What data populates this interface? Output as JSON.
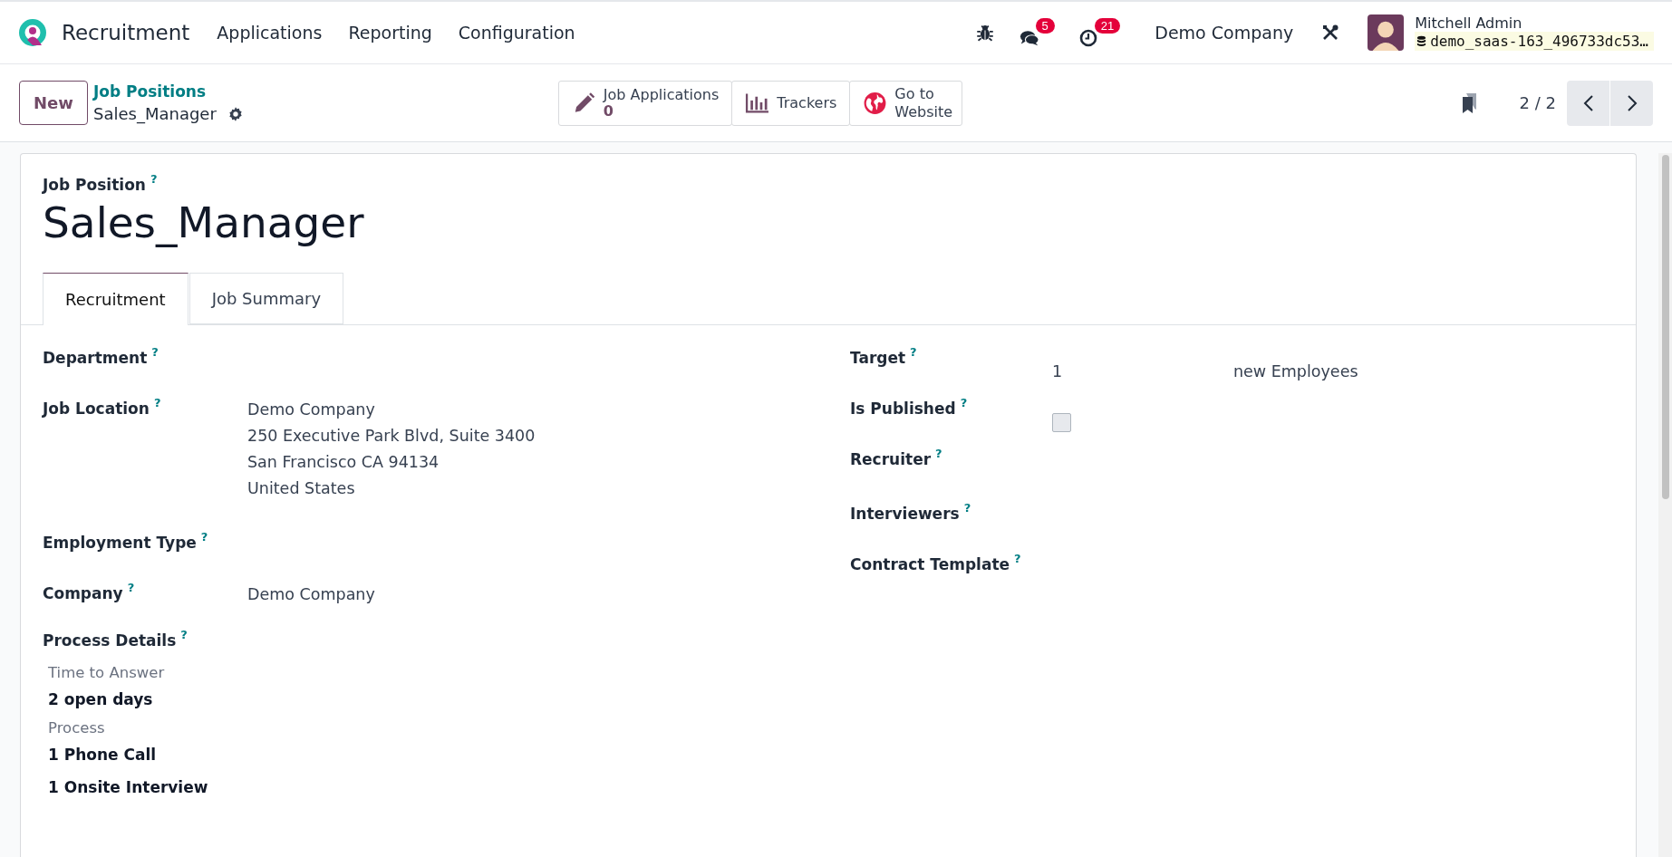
{
  "navbar": {
    "app_name": "Recruitment",
    "menu": [
      "Applications",
      "Reporting",
      "Configuration"
    ],
    "systray": {
      "messages_badge": "5",
      "activities_badge": "21",
      "company": "Demo Company",
      "user": "Mitchell Admin",
      "database": "demo_saas-163_496733dc53…"
    }
  },
  "control_panel": {
    "new_button": "New",
    "breadcrumb": {
      "parent": "Job Positions",
      "current": "Sales_Manager"
    },
    "smart_buttons": [
      {
        "kind": "stat",
        "label": "Job Applications",
        "value": "0"
      },
      {
        "kind": "plain",
        "label": "Trackers"
      },
      {
        "kind": "plain",
        "label": "Go to Website"
      }
    ],
    "pager": "2 / 2"
  },
  "form": {
    "title_label": "Job Position",
    "title_help": "?",
    "title": "Sales_Manager",
    "tabs": [
      {
        "label": "Recruitment",
        "selected": true
      },
      {
        "label": "Job Summary",
        "selected": false
      }
    ],
    "left_fields": [
      {
        "kind": "text",
        "label": "Department",
        "help": "?"
      },
      {
        "kind": "address",
        "label": "Job Location",
        "help": "?",
        "lines": [
          "Demo Company",
          "250 Executive Park Blvd, Suite 3400",
          "San Francisco CA 94134",
          "United States"
        ]
      },
      {
        "kind": "text",
        "label": "Employment Type",
        "help": "?"
      },
      {
        "kind": "text",
        "label": "Company",
        "help": "?",
        "value": "Demo Company"
      }
    ],
    "process": {
      "label": "Process Details",
      "help": "?",
      "sections": [
        {
          "title": "Time to Answer",
          "items": [
            "2 open days"
          ]
        },
        {
          "title": "Process",
          "items": [
            "1 Phone Call",
            "1 Onsite Interview"
          ]
        }
      ]
    },
    "right_fields": [
      {
        "kind": "target",
        "label": "Target",
        "help": "?",
        "value": "1",
        "unit": "new Employees"
      },
      {
        "kind": "checkbox",
        "label": "Is Published",
        "help": "?",
        "checked": false
      },
      {
        "kind": "text",
        "label": "Recruiter",
        "help": "?"
      },
      {
        "kind": "text",
        "label": "Interviewers",
        "help": "?"
      },
      {
        "kind": "text",
        "label": "Contract Template",
        "help": "?"
      }
    ]
  }
}
